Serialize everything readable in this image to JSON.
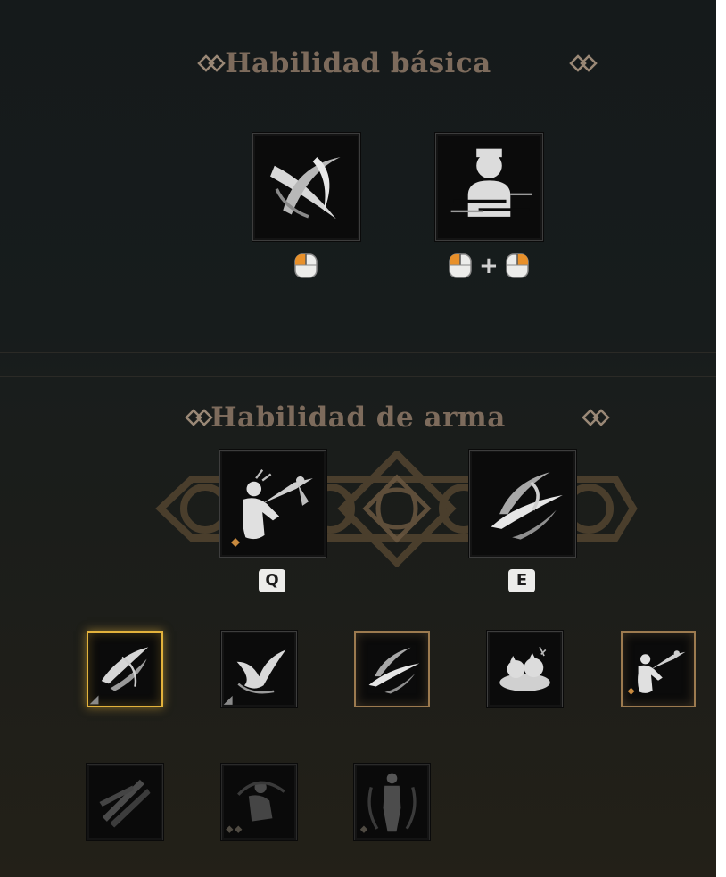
{
  "basic_section": {
    "title": "Habilidad básica",
    "skills": [
      {
        "icon": "crescent-slash-icon",
        "input": "left-mouse-icon"
      },
      {
        "icon": "dodge-silhouette-icon",
        "input": "left-mouse-plus-right-mouse-icon",
        "combo_separator": "+"
      }
    ]
  },
  "weapon_section": {
    "title": "Habilidad de arma",
    "active": [
      {
        "icon": "kick-strike-icon",
        "key": "Q"
      },
      {
        "icon": "wind-slash-icon",
        "key": "E"
      }
    ],
    "pool_row_1": [
      {
        "icon": "blade-swirl-icon",
        "state": "selected"
      },
      {
        "icon": "bird-wind-icon",
        "state": "normal"
      },
      {
        "icon": "wind-slash-icon",
        "state": "equipped"
      },
      {
        "icon": "cloud-creatures-icon",
        "state": "normal"
      },
      {
        "icon": "kick-strike-icon",
        "state": "equipped"
      }
    ],
    "pool_row_2": [
      {
        "icon": "daggers-icon",
        "state": "locked"
      },
      {
        "icon": "shadow-crouch-icon",
        "state": "locked"
      },
      {
        "icon": "standing-warrior-icon",
        "state": "locked"
      }
    ]
  },
  "colors": {
    "title": "#7d6b5c",
    "gold_frame": "#9c7a4f",
    "selected_frame": "#e3b23c",
    "mouse_highlight": "#e8902a",
    "key_badge": "#ececea"
  }
}
